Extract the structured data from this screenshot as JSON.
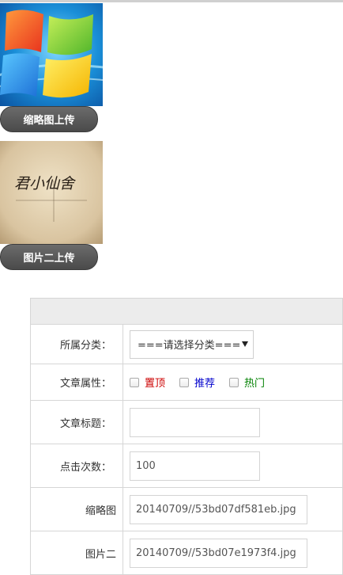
{
  "thumbnail": {
    "upload_label": "缩略图上传"
  },
  "picture_two": {
    "upload_label": "图片二上传",
    "image_caption": "君小仙舍"
  },
  "form": {
    "category": {
      "label": "所属分类：",
      "selected": "===请选择分类==="
    },
    "attributes": {
      "label": "文章属性：",
      "options": [
        {
          "label": "置顶",
          "color": "#cc0000"
        },
        {
          "label": "推荐",
          "color": "#0000cc"
        },
        {
          "label": "热门",
          "color": "#008000"
        }
      ]
    },
    "title": {
      "label": "文章标题：",
      "value": ""
    },
    "hits": {
      "label": "点击次数：",
      "value": "100"
    },
    "thumb_path": {
      "label": "缩略图",
      "value": "20140709//53bd07df581eb.jpg"
    },
    "pic2_path": {
      "label": "图片二",
      "value": "20140709//53bd07e1973f4.jpg"
    }
  },
  "colors": {
    "button_bg": "#555555",
    "header_row_bg": "#ececec",
    "border": "#d6d6d6"
  }
}
